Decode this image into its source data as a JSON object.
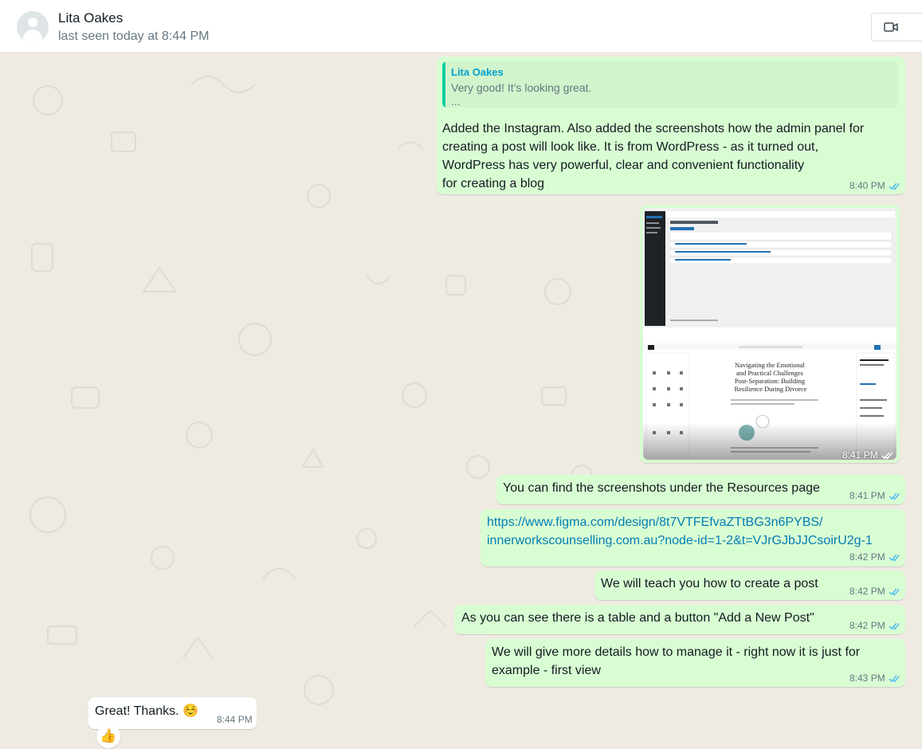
{
  "header": {
    "contact_name": "Lita Oakes",
    "status": "last seen today at 8:44 PM",
    "video_icon": "video-camera-icon"
  },
  "messages": [
    {
      "quote": {
        "author": "Lita Oakes",
        "text": "Very good!  It’s looking great.\n..."
      },
      "text": "Added the Instagram. Also added the screenshots how the admin panel for\ncreating a post will look like. It is from WordPress - as it turned out,\nWordPress has very powerful, clear and convenient functionality\nfor creating a blog",
      "time": "8:40 PM"
    },
    {
      "type": "image",
      "time": "8:41 PM",
      "image_texts": {
        "post_title": "Navigating the Emotional\nand Practical Challenges\nPost-Separation: Building\nResilience During Divorce"
      }
    },
    {
      "text": "You can find the screenshots under the Resources page",
      "time": "8:41 PM"
    },
    {
      "link": "https://www.figma.com/design/8t7VTFEfvaZTtBG3n6PYBS/\ninnerworkscounselling.com.au?node-id=1-2&t=VJrGJbJJCsoirU2g-1",
      "time": "8:42 PM"
    },
    {
      "text": "We will teach you how to create a post",
      "time": "8:42 PM"
    },
    {
      "text": "As you can see there is a table and a button \"Add a New Post\"",
      "time": "8:42 PM"
    },
    {
      "text": "We will give more details how to manage it - right now it is just for\nexample - first view",
      "time": "8:43 PM"
    },
    {
      "text": "Great! Thanks. ☺️",
      "time": "8:44 PM",
      "reaction": "👍"
    }
  ],
  "colors": {
    "outgoing_bubble": "#d9fdd3",
    "incoming_bubble": "#ffffff",
    "chat_background": "#efeae2",
    "read_ticks": "#53bdeb",
    "link": "#027eb5"
  }
}
